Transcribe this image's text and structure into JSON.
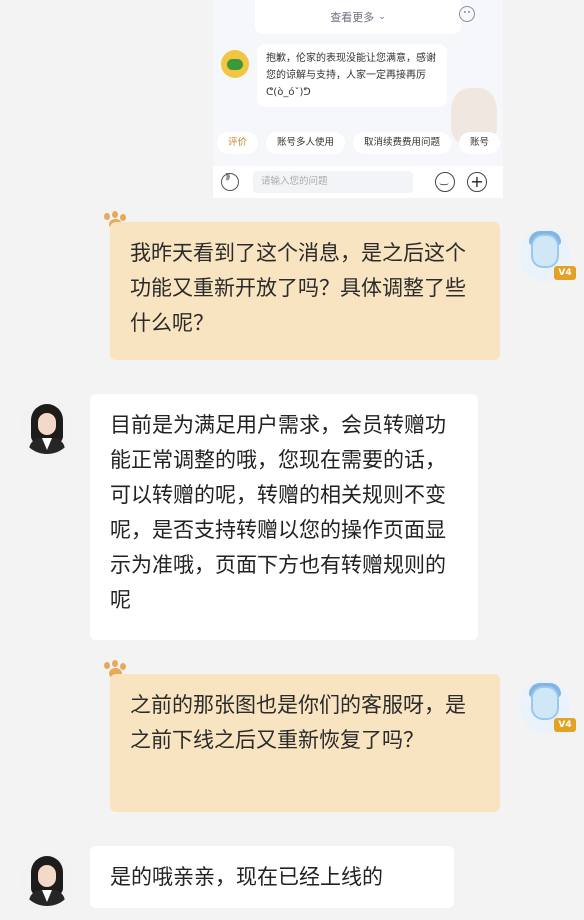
{
  "embedded_chat": {
    "more_label": "查看更多",
    "bot_message": "抱歉，伦家的表现没能让您满意，感谢您的谅解与支持，人家一定再接再厉ᕦ(ò_óˇ)ᕤ",
    "chips": [
      "评价",
      "账号多人使用",
      "取消续费费用问题",
      "账号"
    ],
    "input_placeholder": "请输入您的问题"
  },
  "messages": [
    {
      "sender": "user",
      "text": "我昨天看到了这个消息，是之后这个功能又重新开放了吗？具体调整了些什么呢？",
      "badge": "V4"
    },
    {
      "sender": "agent",
      "text": "目前是为满足用户需求，会员转赠功能正常调整的哦，您现在需要的话，可以转赠的呢，转赠的相关规则不变呢，是否支持转赠以您的操作页面显示为准哦，页面下方也有转赠规则的呢"
    },
    {
      "sender": "user",
      "text": "之前的那张图也是你们的客服呀，是之前下线之后又重新恢复了吗？",
      "badge": "V4"
    },
    {
      "sender": "agent",
      "text": "是的哦亲亲，现在已经上线的"
    }
  ],
  "colors": {
    "user_bubble": "#f9e4c1",
    "agent_bubble": "#ffffff",
    "background": "#f3f3f3"
  }
}
